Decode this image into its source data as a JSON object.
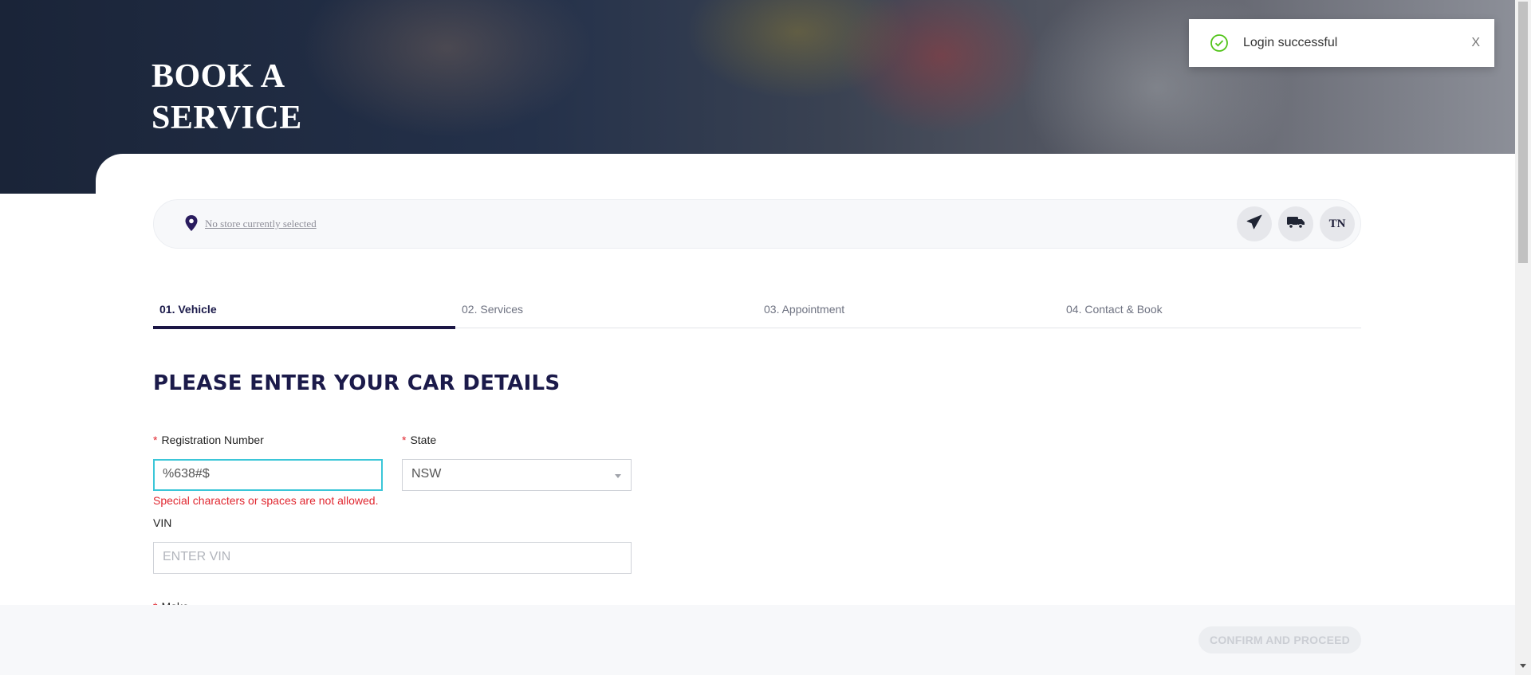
{
  "hero": {
    "title": "BOOK A SERVICE"
  },
  "toast": {
    "message": "Login successful",
    "close_label": "X"
  },
  "store_bar": {
    "store_text": "No store currently selected",
    "account_initials": "TN"
  },
  "steps": [
    {
      "label": "01. Vehicle",
      "active": true
    },
    {
      "label": "02. Services",
      "active": false
    },
    {
      "label": "03. Appointment",
      "active": false
    },
    {
      "label": "04. Contact & Book",
      "active": false
    }
  ],
  "form": {
    "heading": "PLEASE ENTER YOUR CAR DETAILS",
    "registration": {
      "label": "Registration Number",
      "value": "%638#$",
      "error": "Special characters or spaces are not allowed."
    },
    "state": {
      "label": "State",
      "value": "NSW"
    },
    "vin": {
      "label": "VIN",
      "placeholder": "ENTER VIN"
    },
    "make": {
      "label": "Make"
    }
  },
  "footer": {
    "confirm_label": "CONFIRM AND PROCEED"
  },
  "colors": {
    "primary": "#1b1645",
    "error": "#e0262f",
    "focus": "#3bc6d8",
    "success": "#52c41a"
  }
}
